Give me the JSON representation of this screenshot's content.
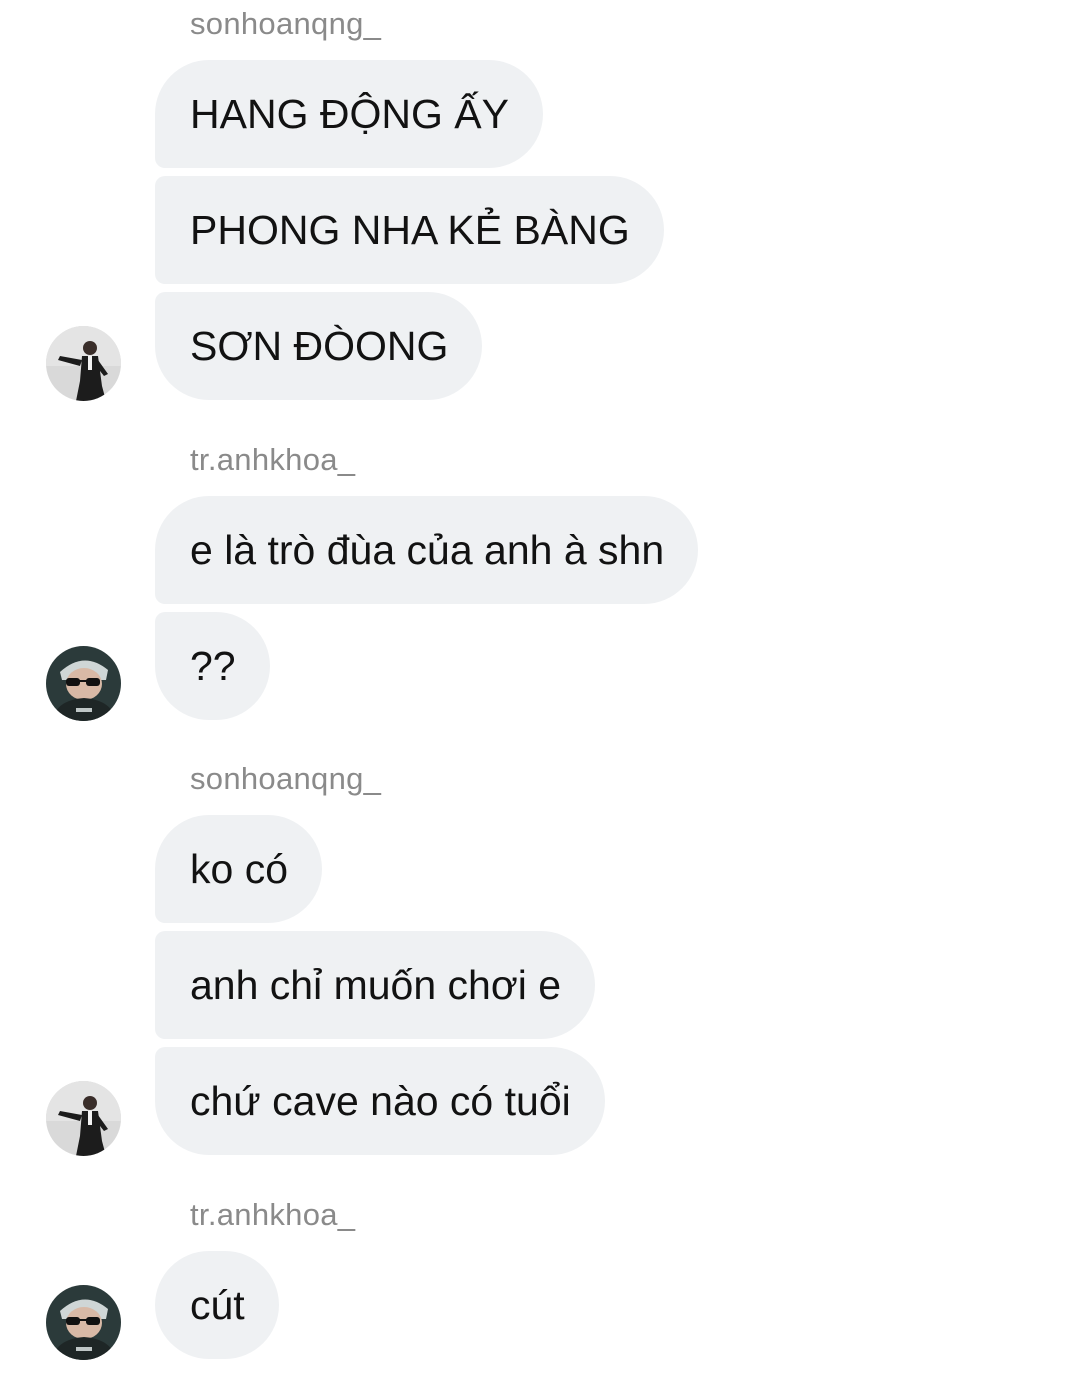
{
  "thread": {
    "groups": [
      {
        "sender": "sonhoanqng_",
        "messages": [
          "HANG ĐỘNG ẤY",
          "PHONG NHA KẺ BÀNG",
          "SƠN ĐÒONG"
        ]
      },
      {
        "sender": "tr.anhkhoa_",
        "messages": [
          "e là trò đùa của anh à shn",
          "??"
        ]
      },
      {
        "sender": "sonhoanqng_",
        "messages": [
          "ko có",
          "anh chỉ muốn chơi e",
          "chứ cave nào có tuổi"
        ]
      },
      {
        "sender": "tr.anhkhoa_",
        "messages": [
          "cút"
        ]
      }
    ]
  }
}
